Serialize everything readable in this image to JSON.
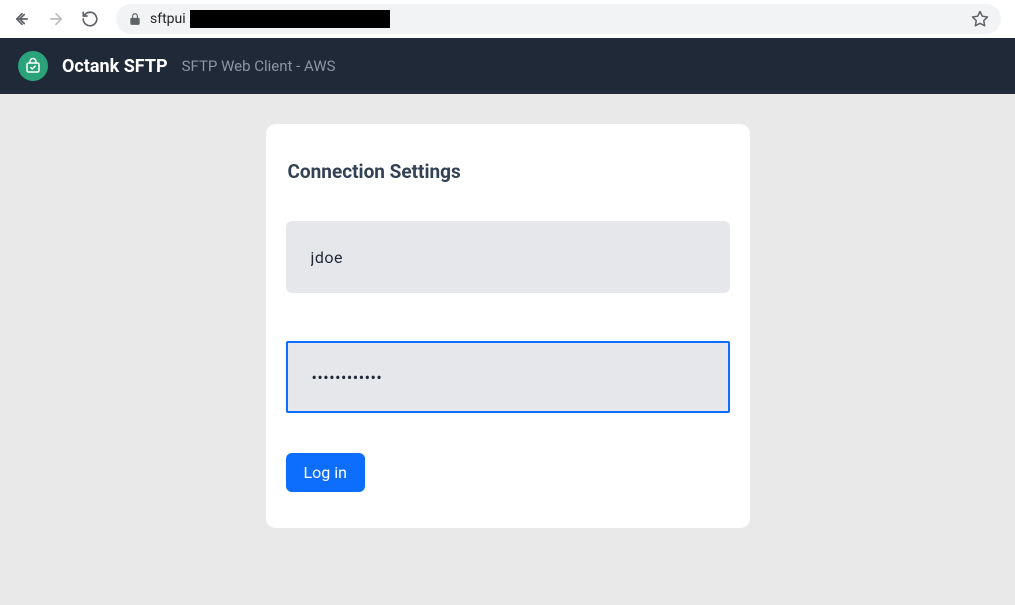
{
  "browser": {
    "url_prefix": "sftpui"
  },
  "header": {
    "brand": "Octank SFTP",
    "subtitle": "SFTP Web Client - AWS"
  },
  "card": {
    "title": "Connection Settings",
    "username_value": "jdoe",
    "password_value": "••••••••••••",
    "login_label": "Log in"
  }
}
